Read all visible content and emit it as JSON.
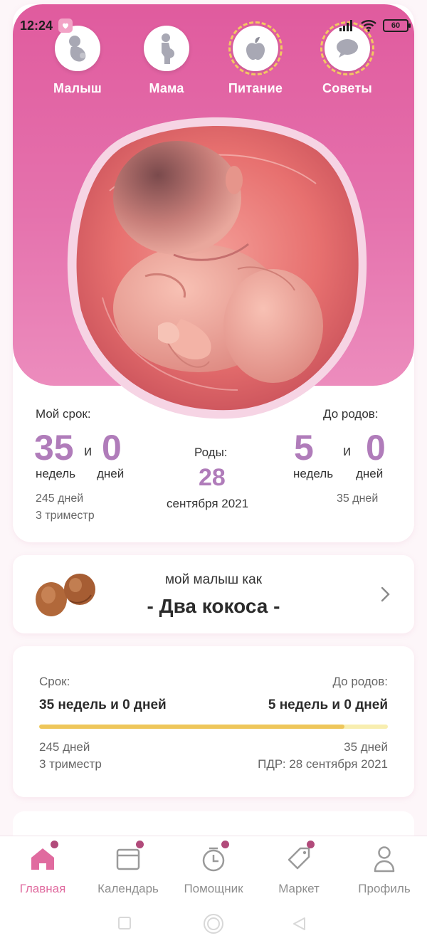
{
  "status": {
    "time": "12:24",
    "battery": "60"
  },
  "top_nav": [
    {
      "label": "Малыш",
      "icon": "baby-icon"
    },
    {
      "label": "Мама",
      "icon": "pregnant-mother-icon"
    },
    {
      "label": "Питание",
      "icon": "apple-icon"
    },
    {
      "label": "Советы",
      "icon": "chat-bubble-icon"
    }
  ],
  "term": {
    "my_term_label": "Мой срок:",
    "weeks": "35",
    "and": "и",
    "days": "0",
    "weeks_unit": "недель",
    "days_unit": "дней",
    "total_days": "245 дней",
    "trimester": "3 триместр"
  },
  "birth": {
    "label": "Роды:",
    "day": "28",
    "month_year": "сентября 2021"
  },
  "until_birth": {
    "label": "До родов:",
    "weeks": "5",
    "and": "и",
    "days": "0",
    "weeks_unit": "недель",
    "days_unit": "дней",
    "total_days": "35 дней"
  },
  "baby_size": {
    "line1": "мой малыш как",
    "line2": "- Два кокоса -"
  },
  "progress": {
    "left_label": "Срок:",
    "right_label": "До родов:",
    "left_value": "35 недель и 0 дней",
    "right_value": "5 недель и 0 дней",
    "fraction": 0.875,
    "left_days": "245 дней",
    "left_trimester": "3 триместр",
    "right_days": "35 дней",
    "due_date": "ПДР: 28 сентября 2021"
  },
  "bottom_nav": [
    {
      "label": "Главная",
      "icon": "home-icon",
      "active": true
    },
    {
      "label": "Календарь",
      "icon": "calendar-icon"
    },
    {
      "label": "Помощник",
      "icon": "timer-icon"
    },
    {
      "label": "Маркет",
      "icon": "tag-icon"
    },
    {
      "label": "Профиль",
      "icon": "profile-icon"
    }
  ],
  "colors": {
    "pink": "#e05b9e",
    "accent_purple": "#b07cba",
    "progress_fill": "#eec65a",
    "active_tab": "#e06b9f"
  }
}
